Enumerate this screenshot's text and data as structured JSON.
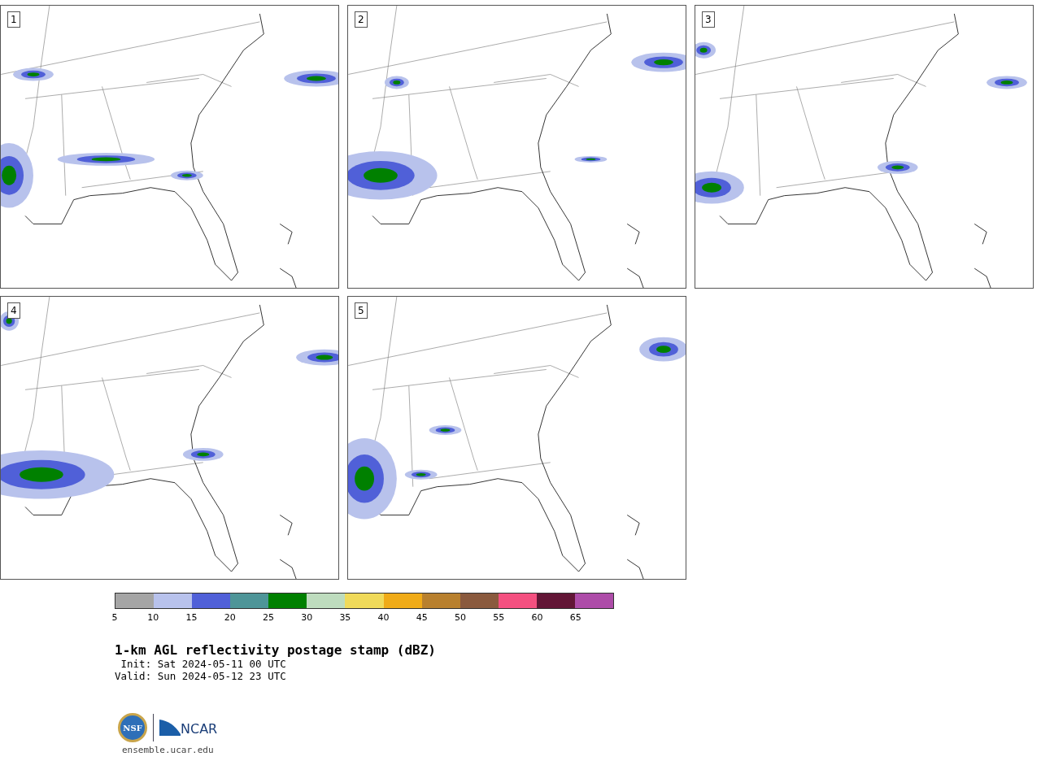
{
  "panels": [
    {
      "number": "1"
    },
    {
      "number": "2"
    },
    {
      "number": "3"
    },
    {
      "number": "4"
    },
    {
      "number": "5"
    }
  ],
  "colorbar": {
    "segments": [
      {
        "color": "#a5a5a5"
      },
      {
        "color": "#b8c2ec"
      },
      {
        "color": "#5060d8"
      },
      {
        "color": "#4e9598"
      },
      {
        "color": "#008000"
      },
      {
        "color": "#bedcbe"
      },
      {
        "color": "#f0da5a"
      },
      {
        "color": "#f0ab18"
      },
      {
        "color": "#b8802e"
      },
      {
        "color": "#8a5a3e"
      },
      {
        "color": "#f45080"
      },
      {
        "color": "#621636"
      },
      {
        "color": "#ad4ca8"
      }
    ],
    "ticks": [
      "5",
      "10",
      "15",
      "20",
      "25",
      "30",
      "35",
      "40",
      "45",
      "50",
      "55",
      "60",
      "65"
    ]
  },
  "title": "1-km AGL reflectivity postage stamp (dBZ)",
  "init": " Init: Sat 2024-05-11 00 UTC",
  "valid": "Valid: Sun 2024-05-12 23 UTC",
  "logos": {
    "nsf": "NSF",
    "ncar": "NCAR"
  },
  "url": "ensemble.ucar.edu"
}
